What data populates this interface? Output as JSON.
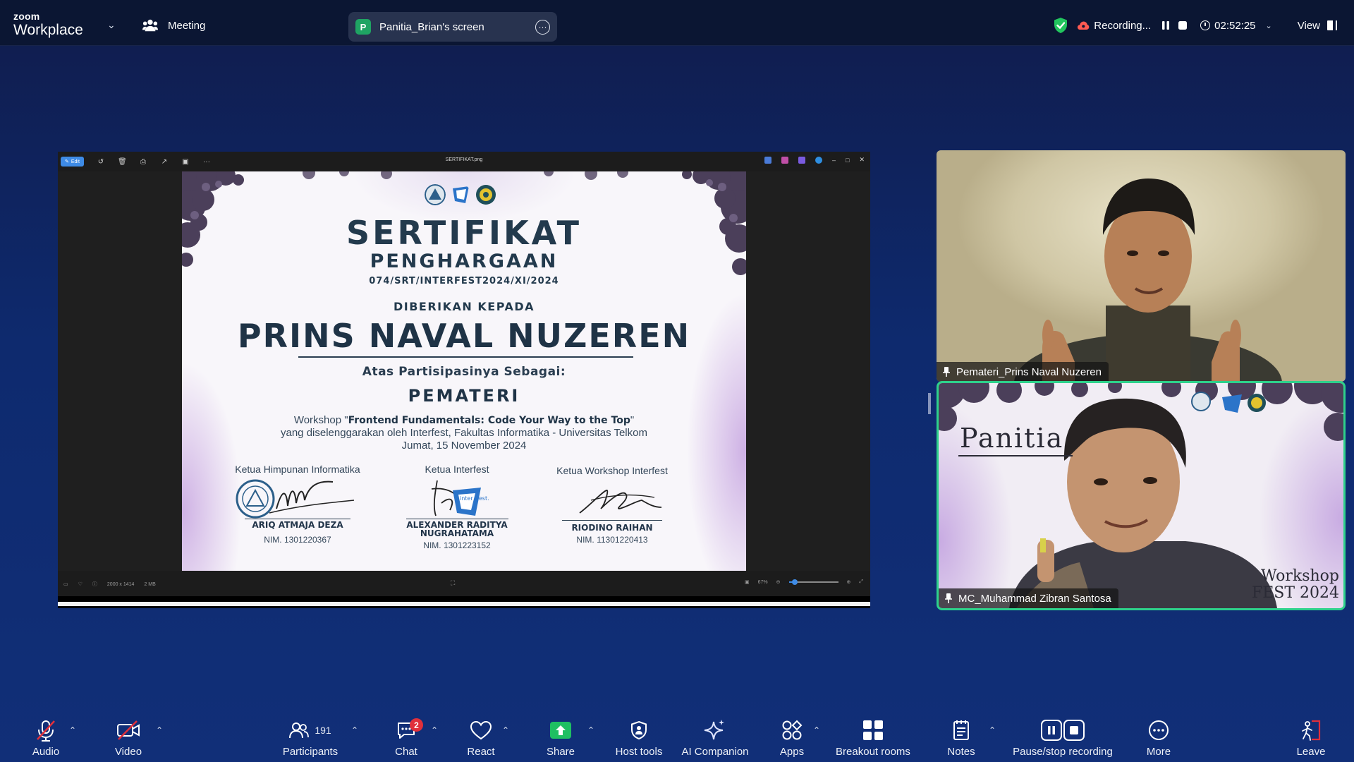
{
  "app": {
    "brand_small": "zoom",
    "brand_large": "Workplace",
    "meeting_label": "Meeting"
  },
  "share": {
    "presenter_initial": "P",
    "presenter_screen": "Panitia_Brian's screen"
  },
  "recording": {
    "status": "Recording...",
    "timer": "02:52:25",
    "view_label": "View",
    "security_color": "#22c55e"
  },
  "photos": {
    "edit_label": "Edit",
    "file_name": "SERTIFIKAT.png",
    "dimensions": "2000 x 1414",
    "file_size": "2 MB",
    "zoom_level": "67%",
    "zoom_fraction": 0.06
  },
  "certificate": {
    "title": "SERTIFIKAT",
    "subtitle": "PENGHARGAAN",
    "number": "074/SRT/INTERFEST2024/XI/2024",
    "given_to": "DIBERIKAN KEPADA",
    "recipient": "PRINS NAVAL NUZEREN",
    "as_label": "Atas Partisipasinya Sebagai:",
    "role": "PEMATERI",
    "body_prefix": "Workshop \"",
    "workshop_title": "Frontend Fundamentals: Code Your Way to the Top",
    "body_suffix": "\"",
    "organizer_line": "yang diselenggarakan oleh Interfest, Fakultas Informatika - Universitas Telkom",
    "date_line": "Jumat, 15 November 2024",
    "signatories": [
      {
        "role": "Ketua Himpunan Informatika",
        "name": "ARIQ ATMAJA DEZA",
        "nim": "NIM. 1301220367"
      },
      {
        "role": "Ketua Interfest",
        "name": "ALEXANDER RADITYA NUGRAHATAMA",
        "nim": "NIM. 1301223152"
      },
      {
        "role": "Ketua Workshop Interfest",
        "name": "RIODINO RAIHAN",
        "nim": "NIM. 11301220413"
      }
    ],
    "stamp_text": "inter -fest."
  },
  "participants": [
    {
      "name": "Pemateri_Prins Naval Nuzeren"
    },
    {
      "name": "MC_Muhammad Zibran Santosa",
      "background_title": "Panitia",
      "background_footer_1": "Workshop",
      "background_footer_2": "FEST 2024",
      "active_speaker_color": "#2ed18b"
    }
  ],
  "toolbar": {
    "audio": "Audio",
    "video": "Video",
    "participants": "Participants",
    "participants_count": "191",
    "chat": "Chat",
    "chat_badge": "2",
    "react": "React",
    "share": "Share",
    "host_tools": "Host tools",
    "ai_companion": "AI Companion",
    "apps": "Apps",
    "breakout_rooms": "Breakout rooms",
    "notes": "Notes",
    "pause_stop_recording": "Pause/stop recording",
    "more": "More",
    "leave": "Leave"
  }
}
